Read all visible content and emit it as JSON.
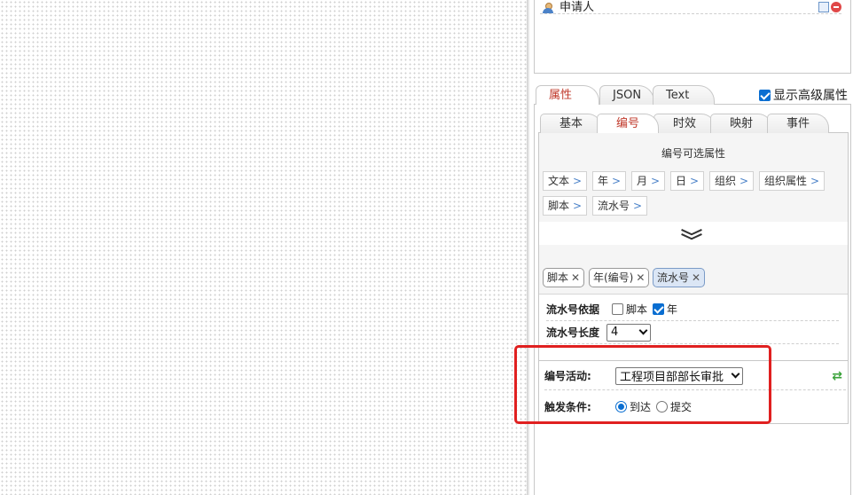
{
  "top_panel": {
    "applicant_label": "申请人"
  },
  "outer_tabs": {
    "items": [
      "属性",
      "JSON",
      "Text"
    ],
    "active": "属性",
    "show_advanced_label": "显示高级属性",
    "show_advanced_checked": true
  },
  "inner_tabs": {
    "items": [
      "基本",
      "编号",
      "时效",
      "映射",
      "事件"
    ],
    "active": "编号"
  },
  "numbering": {
    "title": "编号可选属性",
    "options": [
      "文本",
      "年",
      "月",
      "日",
      "组织",
      "组织属性",
      "脚本",
      "流水号"
    ],
    "selected_tags": [
      "脚本",
      "年(编号)",
      "流水号"
    ],
    "highlighted_tag": "流水号",
    "serial_basis_label": "流水号依据",
    "serial_basis_options": [
      {
        "label": "脚本",
        "checked": false
      },
      {
        "label": "年",
        "checked": true
      }
    ],
    "serial_length_label": "流水号长度",
    "serial_length_value": "4"
  },
  "activity": {
    "label": "编号活动:",
    "value": "工程项目部部长审批",
    "trigger_label": "触发条件:",
    "trigger_options": [
      {
        "label": "到达",
        "checked": true
      },
      {
        "label": "提交",
        "checked": false
      }
    ]
  },
  "colors": {
    "active_tab_text": "#c0392b",
    "highlight_border": "#e02020",
    "accent_blue": "#0a6ed1"
  }
}
